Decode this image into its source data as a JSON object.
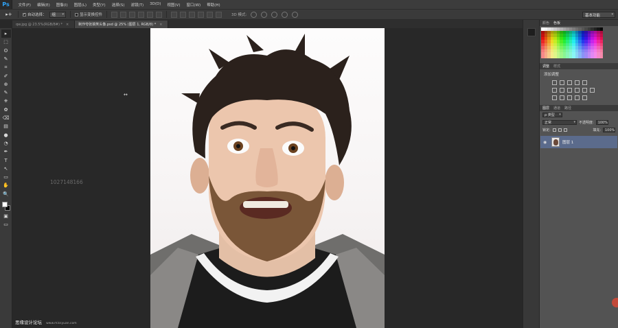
{
  "app": {
    "logo": "Ps"
  },
  "menu": [
    "文件(F)",
    "编辑(E)",
    "图像(I)",
    "图层(L)",
    "类型(Y)",
    "选择(S)",
    "滤镜(T)",
    "3D(D)",
    "视图(V)",
    "窗口(W)",
    "帮助(H)"
  ],
  "options": {
    "tool_glyph": "▸+",
    "auto_select_label": "自动选择：",
    "auto_select_value": "组",
    "show_transform_label": "显示变换控件",
    "mode_label": "3D 模式:",
    "workspace": "基本功能"
  },
  "tabs": [
    {
      "label": "qw.jpg @ 23.5%(RGB/8#) *",
      "close": "×"
    },
    {
      "label": "制作夸张搞笑头像.psd @ 25% (图层 1, RGB/8) *",
      "close": "×"
    }
  ],
  "canvas": {
    "watermark_id": "1027148166",
    "cursor": "↔",
    "site_watermark": "思缘设计论坛",
    "site_watermark_small": "www.missyuan.com"
  },
  "tools": [
    "▸",
    "⬚",
    "ʘ",
    "✎",
    "⌗",
    "✐",
    "⊕",
    "✎",
    "⎈",
    "✿",
    "⌫",
    "▤",
    "●",
    "◔",
    "✒",
    "T",
    "↖",
    "▭",
    "✋",
    "🔍"
  ],
  "panels": {
    "swatches_tabs": [
      "颜色",
      "色板"
    ],
    "adjust_tabs": [
      "调整",
      "样式"
    ],
    "adjust_title": "添加调整",
    "layers_tabs": [
      "图层",
      "通道",
      "路径"
    ],
    "filter_kind": "ρ 类型",
    "blend_mode": "正常",
    "opacity_label": "不透明度:",
    "opacity_value": "100%",
    "lock_label": "锁定:",
    "fill_label": "填充:",
    "fill_value": "100%",
    "layer_name": "图层 1"
  },
  "colors": {
    "layer_selected": "#5b6b8c",
    "ps_blue": "#2fa2f5"
  }
}
